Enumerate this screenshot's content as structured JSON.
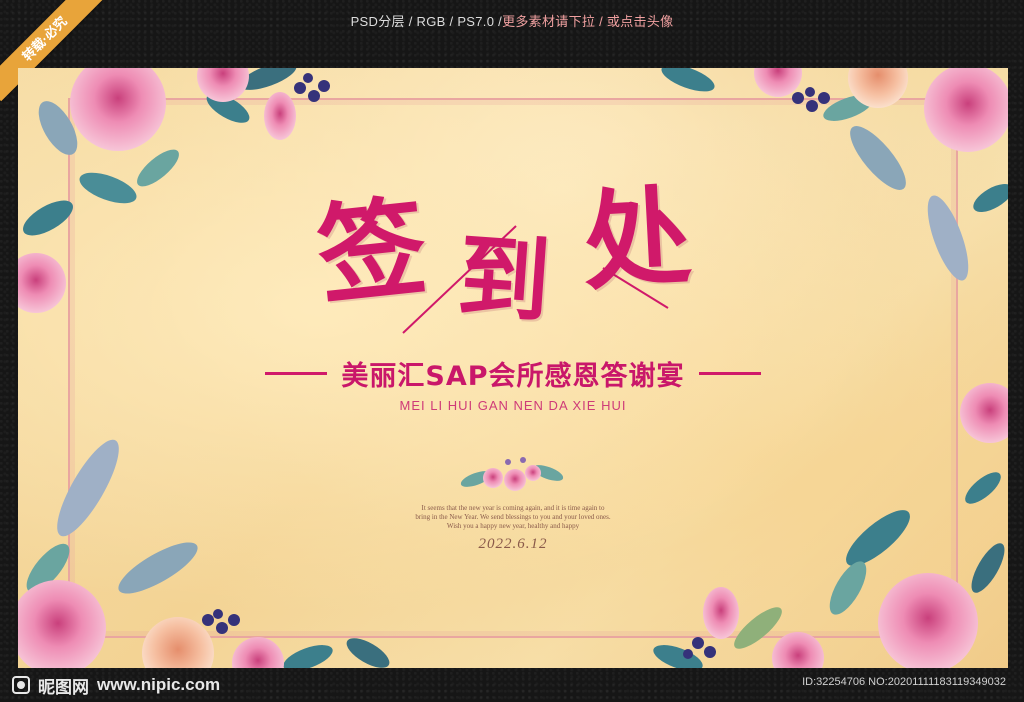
{
  "header": {
    "info_prefix": "PSD分层 / RGB / PS7.0 / ",
    "info_highlight": "更多素材请下拉 / 或点击头像"
  },
  "ribbon": {
    "label": "转载·必究"
  },
  "poster": {
    "title_chars": [
      "签",
      "到",
      "处"
    ],
    "subtitle": "美丽汇SAP会所感恩答谢宴",
    "pinyin": "MEI LI HUI GAN NEN DA XIE HUI",
    "blessing_lines": [
      "It seems that the new year is coming again, and it is time again to",
      "bring in the New Year. We send blessings to you and your loved ones.",
      "Wish you a happy new year, healthy and happy"
    ],
    "date": "2022.6.12"
  },
  "footer": {
    "logo_text": "昵图网",
    "site": "www.nipic.com",
    "id_text": "ID:32254706 NO:20201111183119349032"
  },
  "colors": {
    "title": "#d0196a",
    "frame": "#161616",
    "paper": "#f3d394",
    "border": "#e9a6a0",
    "rose": "#f0a6c4",
    "leaf": "#3c7f8c"
  },
  "icons": [
    "rose-icon",
    "leaf-icon",
    "berry-icon",
    "logo-icon"
  ]
}
